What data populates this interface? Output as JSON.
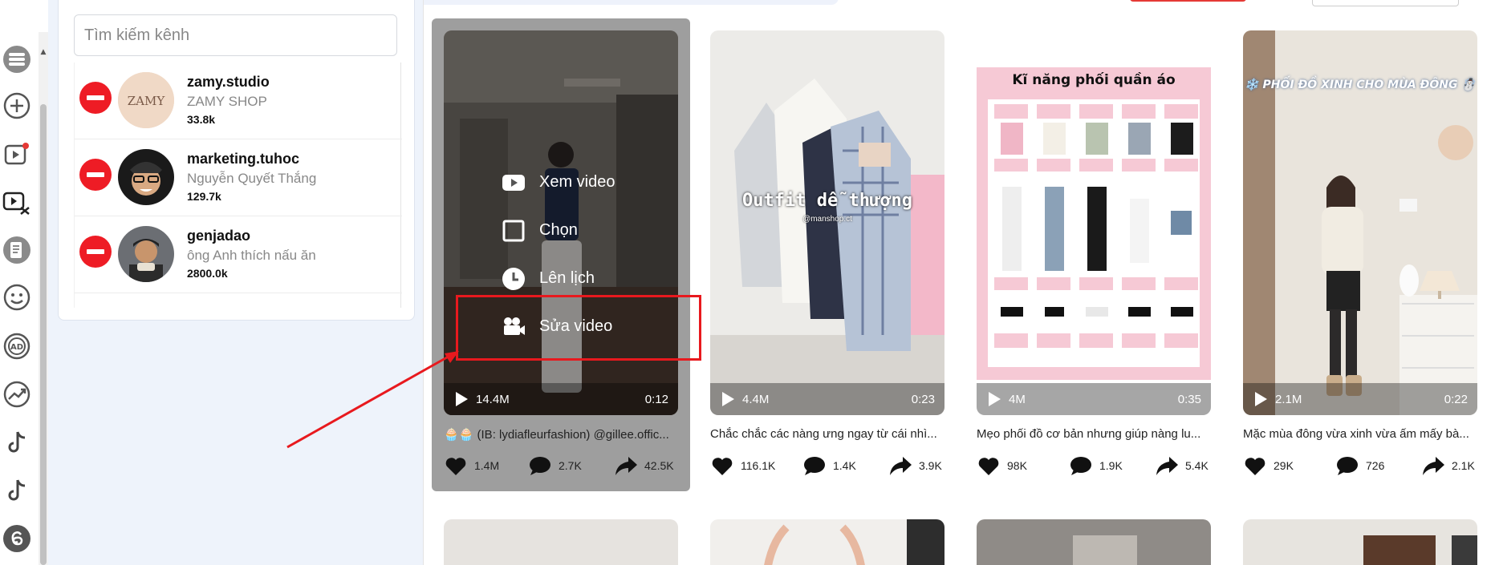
{
  "search": {
    "placeholder": "Tìm kiếm kênh"
  },
  "channels": [
    {
      "handle": "zamy.studio",
      "name": "ZAMY SHOP",
      "followers": "33.8k",
      "avatar_text": "ZAMY"
    },
    {
      "handle": "marketing.tuhoc",
      "name": "Nguyễn Quyết Thắng",
      "followers": "129.7k"
    },
    {
      "handle": "genjadao",
      "name": "ông Anh thích nấu ăn",
      "followers": "2800.0k"
    }
  ],
  "rail_icons": [
    "list-icon",
    "add-circle-icon",
    "video-add-icon",
    "video-edit-icon",
    "document-icon",
    "smile-icon",
    "ad-icon",
    "trending-icon",
    "tiktok-icon",
    "tiktok-icon",
    "threads-icon"
  ],
  "hover_menu": {
    "watch": "Xem video",
    "select": "Chọn",
    "schedule": "Lên lịch",
    "edit": "Sửa video"
  },
  "videos": [
    {
      "views": "14.4M",
      "duration": "0:12",
      "caption": "🧁🧁 (IB: lydiafleurfashion) @gillee.offic...",
      "likes": "1.4M",
      "comments": "2.7K",
      "shares": "42.5K"
    },
    {
      "views": "4.4M",
      "duration": "0:23",
      "caption": "Chắc chắc các nàng ưng ngay từ cái nhì...",
      "likes": "116.1K",
      "comments": "1.4K",
      "shares": "3.9K",
      "overlay_title": "Outfit dễ thượng",
      "overlay_sub": "@manshop.ct"
    },
    {
      "views": "4M",
      "duration": "0:35",
      "caption": "Mẹo phối đồ cơ bản nhưng giúp nàng lu...",
      "likes": "98K",
      "comments": "1.9K",
      "shares": "5.4K",
      "overlay_title": "Kĩ năng phối quần áo"
    },
    {
      "views": "2.1M",
      "duration": "0:22",
      "caption": "Mặc mùa đông vừa xinh vừa ấm mấy bà...",
      "likes": "29K",
      "comments": "726",
      "shares": "2.1K",
      "overlay_title": "❄️ PHỐI ĐỒ XINH CHO MÙA ĐÔNG ☃️"
    }
  ],
  "colors": {
    "remove": "#ee1c25",
    "highlight": "#e8191e",
    "panel_bg": "#eef3fb",
    "selected_card": "#9e9e9e"
  }
}
